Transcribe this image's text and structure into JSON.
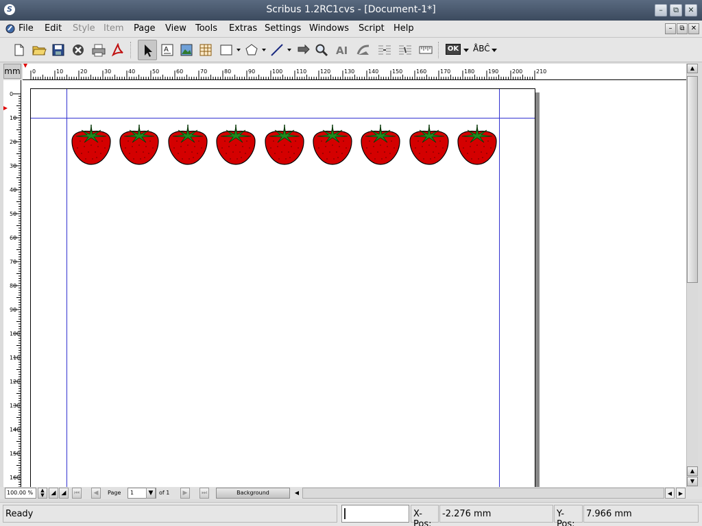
{
  "window": {
    "title": "Scribus 1.2RC1cvs - [Document-1*]",
    "controls": {
      "minimize": "–",
      "restore": "⧉",
      "close": "✕"
    }
  },
  "menu": {
    "items": [
      {
        "label": "File",
        "enabled": true
      },
      {
        "label": "Edit",
        "enabled": true
      },
      {
        "label": "Style",
        "enabled": false
      },
      {
        "label": "Item",
        "enabled": false
      },
      {
        "label": "Page",
        "enabled": true
      },
      {
        "label": "View",
        "enabled": true
      },
      {
        "label": "Tools",
        "enabled": true
      },
      {
        "label": "Extras",
        "enabled": true
      },
      {
        "label": "Settings",
        "enabled": true
      },
      {
        "label": "Windows",
        "enabled": true
      },
      {
        "label": "Script",
        "enabled": true
      },
      {
        "label": "Help",
        "enabled": true
      }
    ]
  },
  "toolbar": {
    "icons": [
      "new-document-icon",
      "open-folder-icon",
      "save-icon",
      "close-document-icon",
      "print-icon",
      "export-pdf-icon",
      "select-pointer-icon",
      "text-frame-icon",
      "image-frame-icon",
      "table-icon",
      "shape-rectangle-icon",
      "polygon-icon",
      "line-icon",
      "rotate-icon",
      "zoom-icon",
      "edit-text-icon",
      "bezier-icon",
      "link-frames-icon",
      "unlink-frames-icon",
      "measure-icon",
      "pdf-button-icon",
      "spellcheck-icon"
    ],
    "pdf_button_label": "OK",
    "spell_label": "ÅBĈ"
  },
  "rulers": {
    "unit": "mm",
    "horizontal_ticks": [
      "0",
      "10",
      "20",
      "30",
      "40",
      "50",
      "60",
      "70",
      "80",
      "90",
      "100",
      "110",
      "120",
      "130",
      "140",
      "150",
      "160",
      "170",
      "180",
      "190",
      "200",
      "210"
    ],
    "vertical_ticks": [
      "0",
      "10",
      "20",
      "30",
      "40",
      "50",
      "60",
      "70",
      "80",
      "90",
      "100",
      "110",
      "120",
      "130",
      "140",
      "150",
      "160"
    ]
  },
  "canvas": {
    "strawberry_count": 9,
    "colors": {
      "guide": "#3030d0",
      "berry": "#d40000",
      "leaf": "#1e8a1e"
    }
  },
  "navbar": {
    "zoom": "100.00 %",
    "page_label": "Page",
    "page_value": "1",
    "page_of": "of 1",
    "layer": "Background"
  },
  "statusbar": {
    "status": "Ready",
    "xpos_label": "X-Pos:",
    "xpos_value": "-2.276 mm",
    "ypos_label": "Y-Pos:",
    "ypos_value": "7.966 mm"
  }
}
